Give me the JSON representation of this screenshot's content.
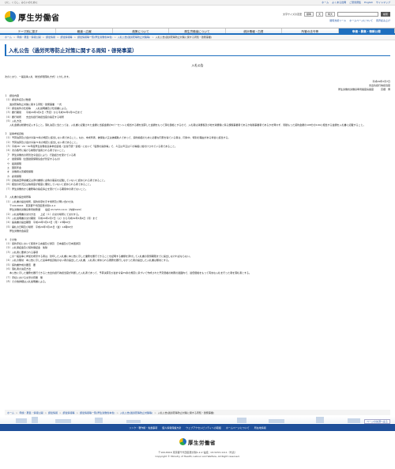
{
  "topbar": {
    "tagline": "ひと、くらし、みらいのために",
    "links": [
      "ホーム",
      "よくある質問",
      "ご意見募集",
      "English",
      "サイトマップ"
    ]
  },
  "header": {
    "logo_text": "厚生労働省",
    "text_size_label": "文字サイズの変更",
    "size_options": [
      "標準",
      "大",
      "特大"
    ],
    "search_placeholder": "",
    "search_button": "検索",
    "links": [
      "閲覧支援ツール",
      "ホームページについて",
      "音声読み上げ"
    ]
  },
  "gnav": {
    "items": [
      "テーマ別に探す",
      "報道・広報",
      "政策について",
      "厚生労働省について",
      "統計情報・白書",
      "所管の法令等",
      "申請・募集・情報公開"
    ],
    "active_index": 6
  },
  "breadcrumb": {
    "items": [
      "ホーム",
      "申請・募集・情報公開",
      "調達情報",
      "調達情報等",
      "調達情報等一覧(厚生労働省本省)",
      "入札公告(過労死等防止対策等)"
    ],
    "current": "入札公告(過労死等防止対策に関する周知・啓発事業)"
  },
  "page": {
    "title": "入札公告（過労死等防止対策に関する周知・啓発事業）",
    "notice_heading": "入札公告",
    "intro": "次のとおり、一般競争入札（総合評価落札方式）に付します。",
    "signature": [
      "平成29年2月7日",
      "支出負担行為担当官",
      "厚生労働省労働基準局長官房長官　　　高畑　博"
    ]
  },
  "body_lines": [
    "１　調達内容",
    "（１）調達件名及び数量",
    "　　過労死等防止対策に関する周知・啓発事業　一式",
    "（２）調達案件の仕様等　　入札説明書及び仕様書による。",
    "（３）履行期間　　平成29年4月1日（予定）から平成30年3月31日まで",
    "（４）履行場所　　支出負担行為担当官の指定する場所",
    "（５）入札方法",
    "　　入札金額は総額を記入すること。落札決定に当たっては、入札書に記載された金額に当該金額の8パーセントに相当する額を加算した金額をもって落札価格とするので、入札者は消費税及び地方消費税に係る課税事業者であるか免税事業者であるかを問わず、見積もった契約金額の108分の100に相当する金額を入札書に記載すること。",
    "",
    "２　競争参加資格",
    "（１）予算決算及び会計令第70条の規定に該当しない者であること。なお、未成年者、被保佐人又は被補助人であって、契約締結のために必要な同意を得ている者は、同条中、特別の理由がある場合に該当する。",
    "（２）予算決算及び会計令第71条の規定に該当しない者であること。",
    "（３）平成28・29・30年度厚生労働省競争参加資格（全省庁統一資格）において「役務の提供等」で、Ａ又はＢ又はＣの等級に格付けされている者であること。",
    "（４）次の各号に掲げる制限が適用される者でないこと。",
    "　ア　厚生労働省の所管法令違反により、行政処分を受けている者",
    "　イ　健康保険（全国健康保険協会が管掌するもの）",
    "　ウ　船員保険",
    "　エ　国民年金",
    "　オ　労働者災害補償保険",
    "　カ　雇用保険",
    "（５）資格審査申請書又は添付書類に虚偽の事実を記載していないと認められる者であること。",
    "（６）経営の状況又は信用度が極度に悪化していないと認められる者であること。",
    "（７）厚生労働省から業務等の指名停止を受けている期間中の者でないこと。",
    "",
    "３　入札書の提出場所等",
    "（１）入札書の提出場所、契約条項を示す場所及び問い合わせ先",
    "　　〒100-8916　東京都千代田区霞が関1-2-2",
    "　　厚生労働省労働基準局総務課　　電話 03-5253-1111（内線5420）",
    "（２）入札説明書の交付方法　　上記（１）の交付場所にて交付する。",
    "（３）入札説明書の交付期間　平成29年2月7日（火）から平成29年3月6日（月）まで",
    "（４）提案書の提出期限　平成29年3月13日（月）17時00分",
    "（５）開札の日時及び場所　平成29年3月24日（金）14時00分",
    "　　厚生労働省会議室",
    "",
    "４　その他",
    "（１）契約手続において使用する言語及び通貨　日本語及び日本国通貨",
    "（２）入札保証金及び契約保証金　免除",
    "（３）入札者に要求される事項",
    "　　この一般競争に参加を希望する者は、封印した入札書に本公告に示した業務を履行できることを証明する書類を添付して入札書の受領期限までに提出しなければならない。",
    "（４）入札の無効　本公告に示した競争参加資格のない者の提出した入札書、入札者に求められる義務を履行しなかった者の提出した入札書は無効とする。",
    "（５）契約書作成の要否　要",
    "（６）落札者の決定方法",
    "　　本公告に示した業務を履行できると支出負担行為担当官が判断した入札者であって、予算決算及び会計令第79条の規定に基づいて作成された予定価格の制限の範囲内で、最低価格をもって有効な入札を行った者を落札者とする。",
    "（７）手続における交渉の有無　無",
    "（８）その他詳細は入札説明書による。"
  ],
  "footer": {
    "breadcrumb": [
      "ホーム",
      "申請・募集・情報公開",
      "調達情報",
      "調達情報等",
      "調達情報等一覧(厚生労働省本省)",
      "入札公告(過労死等防止対策等)"
    ],
    "breadcrumb_current": "入札公告(過労死等防止対策に関する周知・啓発事業)",
    "pagetop": "ページの先頭へ戻る",
    "nav": [
      "リンク・著作権・免責事項",
      "個人情報保護方針",
      "ウェブアクセシビリティへの取組",
      "ホームページについて",
      "所在地情報"
    ],
    "logo_text": "厚生労働省",
    "address": "〒100-8916 東京都千代田区霞が関1-2-2 電話：03-5253-1111（代表）",
    "copyright": "Copyright © Ministry of Health, Labour and Welfare, All Right reserved."
  }
}
